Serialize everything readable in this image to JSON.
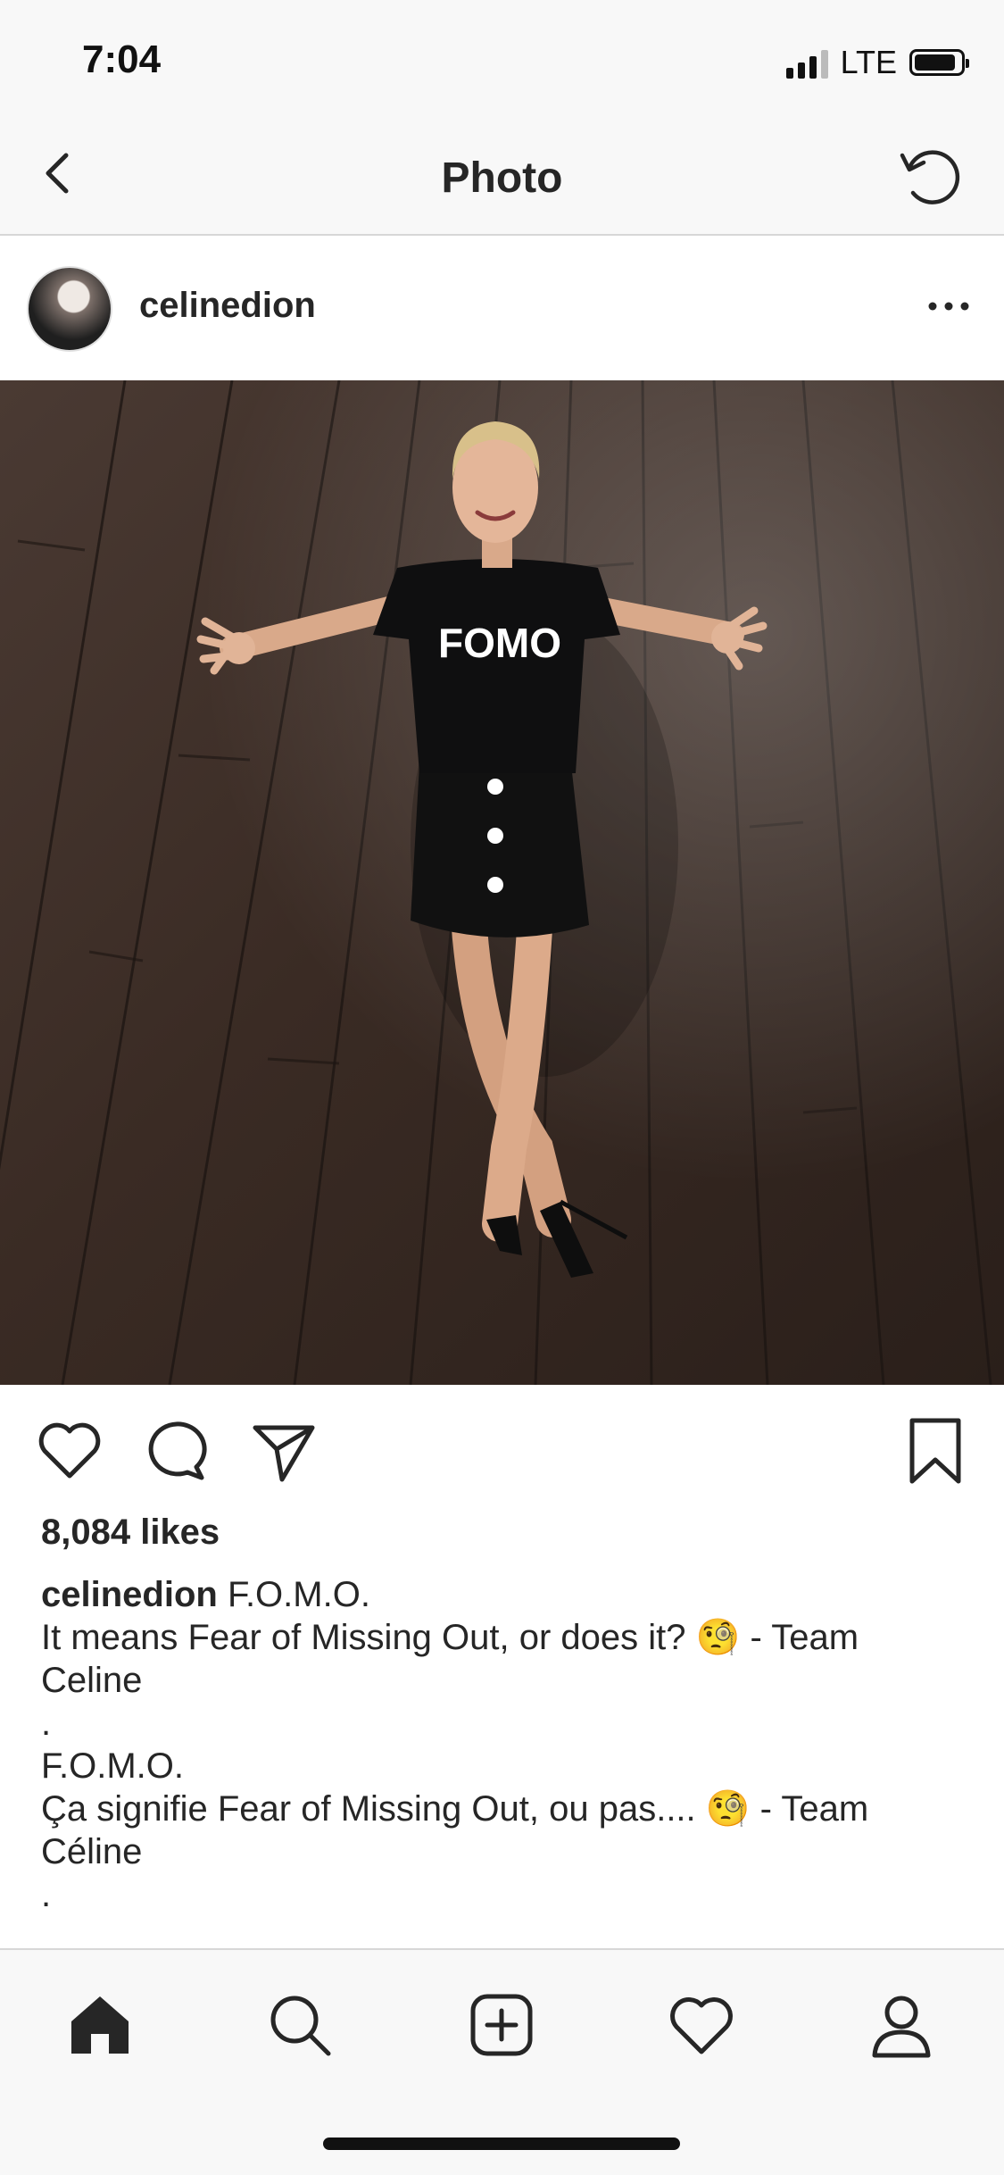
{
  "status_bar": {
    "time": "7:04",
    "network": "LTE",
    "battery_level": 0.9
  },
  "nav": {
    "title": "Photo",
    "back_icon": "chevron-left-icon",
    "refresh_icon": "refresh-icon"
  },
  "post": {
    "username": "celinedion",
    "shirt_text": "FOMO",
    "likes": "8,084 likes",
    "caption": {
      "username": "celinedion",
      "first_line": "F.O.M.O.",
      "lines": [
        "It means Fear of Missing Out, or does it? 🧐 - Team Celine",
        ".",
        "F.O.M.O.",
        "Ça signifie Fear of Missing Out, ou pas.... 🧐 - Team Céline",
        "."
      ]
    }
  },
  "actions": {
    "like": "heart-icon",
    "comment": "comment-icon",
    "share": "send-icon",
    "save": "bookmark-icon"
  },
  "tab_bar": [
    "home-icon",
    "search-icon",
    "add-post-icon",
    "activity-heart-icon",
    "profile-icon"
  ],
  "colors": {
    "text": "#262626",
    "bar_background": "#f8f8f8",
    "divider": "#d7d7d7",
    "floor": "#3b2b24"
  }
}
